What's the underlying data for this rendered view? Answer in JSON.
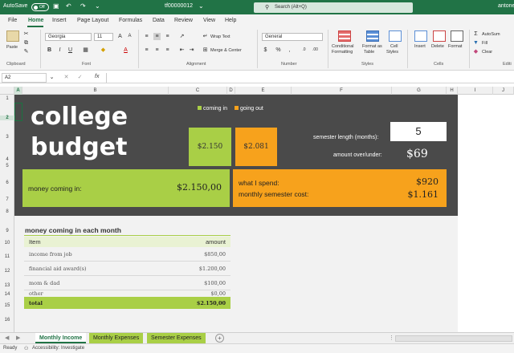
{
  "titlebar": {
    "autosave": "AutoSave",
    "toggle": "Off",
    "filename": "tf00000012",
    "search_placeholder": "Search (Alt+Q)",
    "user": "antone"
  },
  "tabs": [
    "File",
    "Home",
    "Insert",
    "Page Layout",
    "Formulas",
    "Data",
    "Review",
    "View",
    "Help"
  ],
  "ribbon": {
    "clipboard": {
      "paste": "Paste",
      "label": "Clipboard"
    },
    "font": {
      "name": "Georgia",
      "size": "11",
      "label": "Font"
    },
    "alignment": {
      "wrap": "Wrap Text",
      "merge": "Merge & Center",
      "label": "Alignment"
    },
    "number": {
      "format": "General",
      "label": "Number"
    },
    "styles": {
      "conditional": "Conditional",
      "conditional2": "Formatting",
      "format_as": "Format as",
      "format_as2": "Table",
      "cell": "Cell",
      "cell2": "Styles",
      "label": "Styles"
    },
    "cells": {
      "insert": "Insert",
      "delete": "Delete",
      "format": "Format",
      "label": "Cells"
    },
    "editing": {
      "autosum": "AutoSum",
      "fill": "Fill",
      "clear": "Clear",
      "label": "Editi"
    }
  },
  "formula_bar": {
    "name_box": "A2",
    "fx": "fx",
    "value": ""
  },
  "columns": [
    "A",
    "B",
    "C",
    "D",
    "E",
    "F",
    "G",
    "H",
    "I",
    "J"
  ],
  "rows": [
    "1",
    "2",
    "3",
    "4",
    "5",
    "6",
    "7",
    "8",
    "9",
    "10",
    "11",
    "12",
    "13",
    "14",
    "15",
    "16"
  ],
  "sheet": {
    "title_line1": "college",
    "title_line2": "budget",
    "legend_in": "coming in",
    "legend_out": "going out",
    "box_in": "$2.150",
    "box_out": "$2.081",
    "semester_label": "semester length (months):",
    "semester_value": "5",
    "over_under_label": "amount over/under:",
    "over_under_value": "$69",
    "money_in_label": "money coming in:",
    "money_in_value": "$2.150,00",
    "spend_label": "what I spend:",
    "spend_value": "$920",
    "semester_cost_label": "monthly semester cost:",
    "semester_cost_value": "$1.161",
    "table": {
      "title": "money coming in each month",
      "col_item": "Item",
      "col_amount": "amount",
      "rows": [
        {
          "item": "income from job",
          "amount": "$850,00"
        },
        {
          "item": "financial aid award(s)",
          "amount": "$1.200,00"
        },
        {
          "item": "mom & dad",
          "amount": "$100,00"
        },
        {
          "item": "other",
          "amount": "$0,00"
        }
      ],
      "total_label": "total",
      "total_value": "$2.150,00"
    }
  },
  "sheet_tabs": [
    "Monthly Income",
    "Monthly Expenses",
    "Semester Expenses"
  ],
  "status": {
    "ready": "Ready",
    "accessibility": "Accessibility: Investigate"
  },
  "colors": {
    "excel_green": "#217346",
    "coming_in": "#a9cf46",
    "going_out": "#f7a21c",
    "dark_band": "#4a4a4a"
  }
}
